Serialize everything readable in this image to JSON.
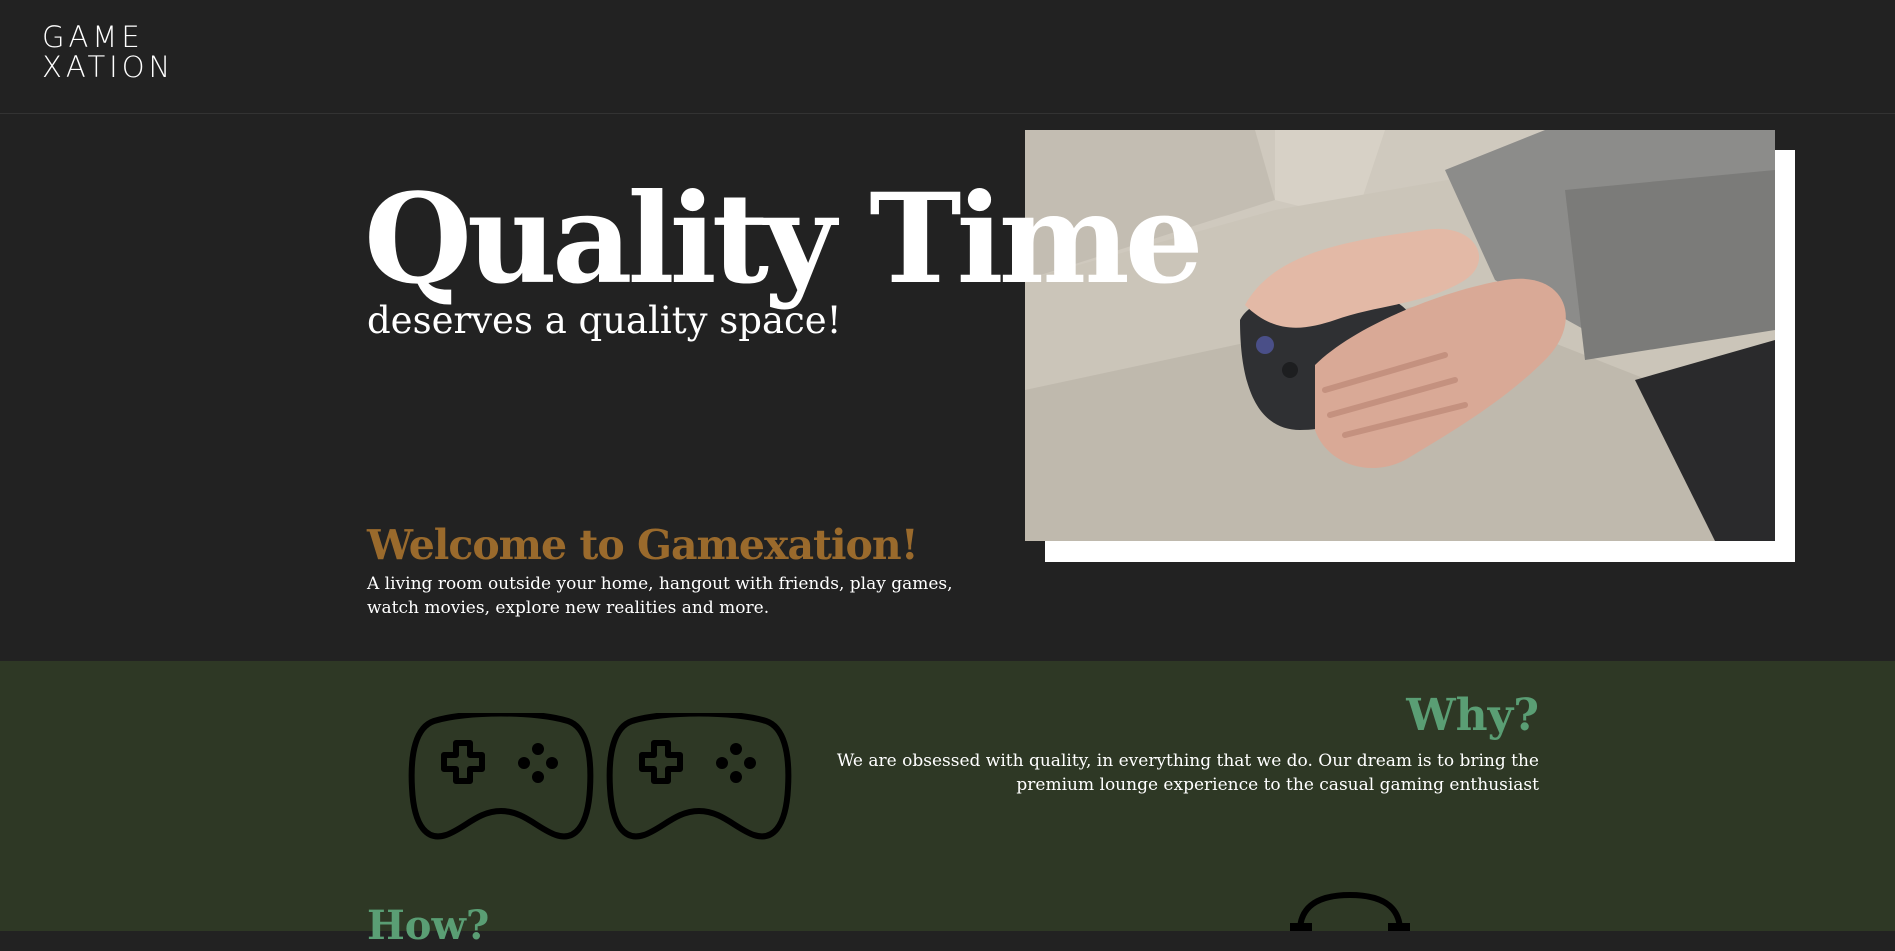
{
  "header": {
    "logo": {
      "line1": "GAME",
      "line2": "XATION"
    }
  },
  "hero": {
    "title": "Quality Time",
    "subtitle": "deserves a quality space!",
    "photo_icon": "hands-holding-game-controller-photo"
  },
  "welcome": {
    "title": "Welcome to Gamexation!",
    "text": "A living room outside your home, hangout with friends, play games, watch movies, explore new realities and more."
  },
  "why": {
    "icon": "game-controller-icon",
    "title": "Why?",
    "text": "We are obsessed with quality, in everything that we do. Our dream is to bring the premium lounge experience to the casual gaming enthusiast"
  },
  "how": {
    "title": "How?",
    "icon": "headset-icon"
  },
  "colors": {
    "background": "#222222",
    "accent_orange": "#9a6a2c",
    "section_green": "#2e3825",
    "accent_green": "#5a9e74"
  }
}
